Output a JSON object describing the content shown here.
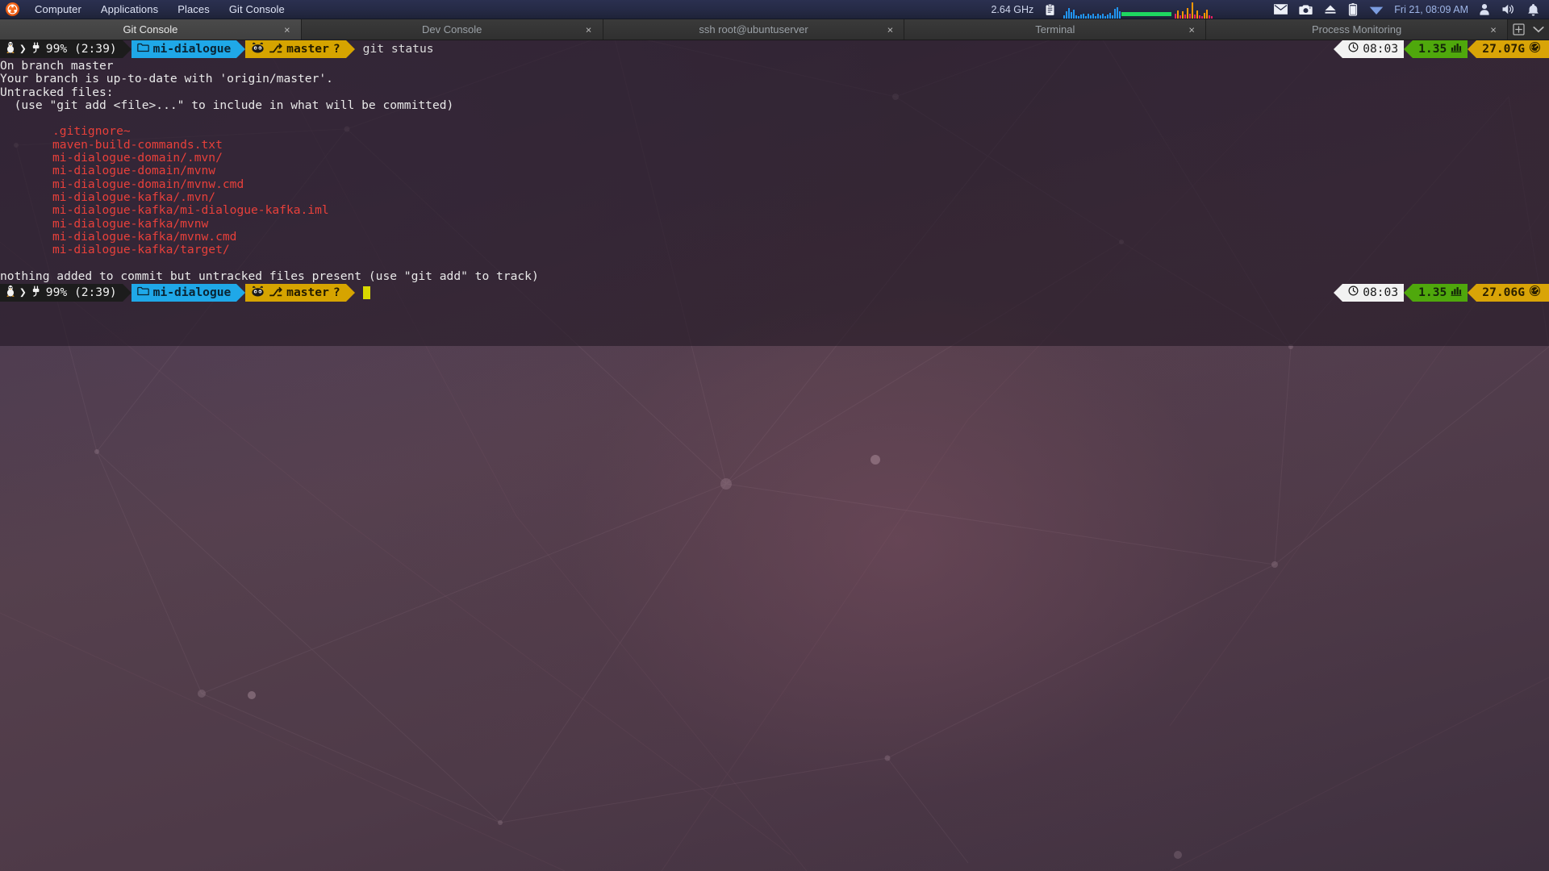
{
  "panel": {
    "logo_icon": "ubuntu-logo-icon",
    "menus": [
      {
        "label": "Computer",
        "name": "menu-computer"
      },
      {
        "label": "Applications",
        "name": "menu-applications"
      },
      {
        "label": "Places",
        "name": "menu-places"
      },
      {
        "label": "Git Console",
        "name": "menu-git-console"
      }
    ],
    "cpu_freq": "2.64 GHz",
    "clipboard_icon": "clipboard-icon",
    "cpu_graph_icon": "cpu-graph-monitor",
    "memory_graph_icon": "memory-graph-monitor",
    "tray": [
      {
        "name": "mail-icon",
        "glyph": "mail"
      },
      {
        "name": "camera-icon",
        "glyph": "camera"
      },
      {
        "name": "eject-icon",
        "glyph": "eject"
      },
      {
        "name": "battery-icon",
        "glyph": "battery"
      },
      {
        "name": "wifi-icon",
        "glyph": "wifi"
      }
    ],
    "datetime": "Fri 21, 08:09 AM",
    "tray_right": [
      {
        "name": "user-account-icon",
        "glyph": "user"
      },
      {
        "name": "volume-icon",
        "glyph": "volume"
      },
      {
        "name": "notifications-bell-icon",
        "glyph": "bell"
      }
    ]
  },
  "window": {
    "tabs": [
      {
        "label": "Git Console",
        "active": true,
        "close": "×"
      },
      {
        "label": "Dev Console",
        "active": false,
        "close": "×"
      },
      {
        "label": "ssh root@ubuntuserver",
        "active": false,
        "close": "×"
      },
      {
        "label": "Terminal",
        "active": false,
        "close": "×"
      },
      {
        "label": "Process Monitoring",
        "active": false,
        "close": "×"
      }
    ],
    "new_tab_icon": "new-tab-icon",
    "tab_menu_icon": "chevron-down-icon"
  },
  "terminal": {
    "prompt_top": {
      "os_icon": "linux-tux-icon",
      "chevron": "❯",
      "plug_icon": "power-plug-icon",
      "battery": "99% (2:39)",
      "folder_icon": "folder-icon",
      "directory": "mi-dialogue",
      "git_icon": "github-octocat-icon",
      "branch_glyph": "⎇",
      "branch": "master",
      "dirty_marker": "?",
      "command": "git status"
    },
    "right_status_top": {
      "clock_icon": "clock-icon",
      "time": "08:03",
      "load": "1.35",
      "load_icon": "bar-chart-icon",
      "memory": "27.07G",
      "memory_icon": "speedometer-icon"
    },
    "output": [
      {
        "text": "On branch master",
        "color": "white"
      },
      {
        "text": "Your branch is up-to-date with 'origin/master'.",
        "color": "white"
      },
      {
        "text": "Untracked files:",
        "color": "white"
      },
      {
        "text": "  (use \"git add <file>...\" to include in what will be committed)",
        "color": "white"
      },
      {
        "text": "",
        "color": "white"
      },
      {
        "text": "\tmi-dialogue-domain/.mvn/",
        "color": "hidden"
      }
    ],
    "untracked_files": [
      ".gitignore~",
      "maven-build-commands.txt",
      "mi-dialogue-domain/.mvn/",
      "mi-dialogue-domain/mvnw",
      "mi-dialogue-domain/mvnw.cmd",
      "mi-dialogue-kafka/.mvn/",
      "mi-dialogue-kafka/mi-dialogue-kafka.iml",
      "mi-dialogue-kafka/mvnw",
      "mi-dialogue-kafka/mvnw.cmd",
      "mi-dialogue-kafka/target/"
    ],
    "footer_line": "nothing added to commit but untracked files present (use \"git add\" to track)",
    "prompt_bottom": {
      "os_icon": "linux-tux-icon",
      "chevron": "❯",
      "plug_icon": "power-plug-icon",
      "battery": "99% (2:39)",
      "folder_icon": "folder-icon",
      "directory": "mi-dialogue",
      "git_icon": "github-octocat-icon",
      "branch_glyph": "⎇",
      "branch": "master",
      "dirty_marker": "?",
      "command": ""
    },
    "right_status_bottom": {
      "clock_icon": "clock-icon",
      "time": "08:03",
      "load": "1.35",
      "load_icon": "bar-chart-icon",
      "memory": "27.06G",
      "memory_icon": "speedometer-icon"
    }
  },
  "colors": {
    "panel_bg": "#252a45",
    "accent_blue": "#1fa8e8",
    "accent_yellow": "#d6a400",
    "untracked_red": "#e8403a",
    "load_green": "#4fa80c",
    "mem_orange": "#d9a407",
    "cursor": "#d9d900"
  }
}
